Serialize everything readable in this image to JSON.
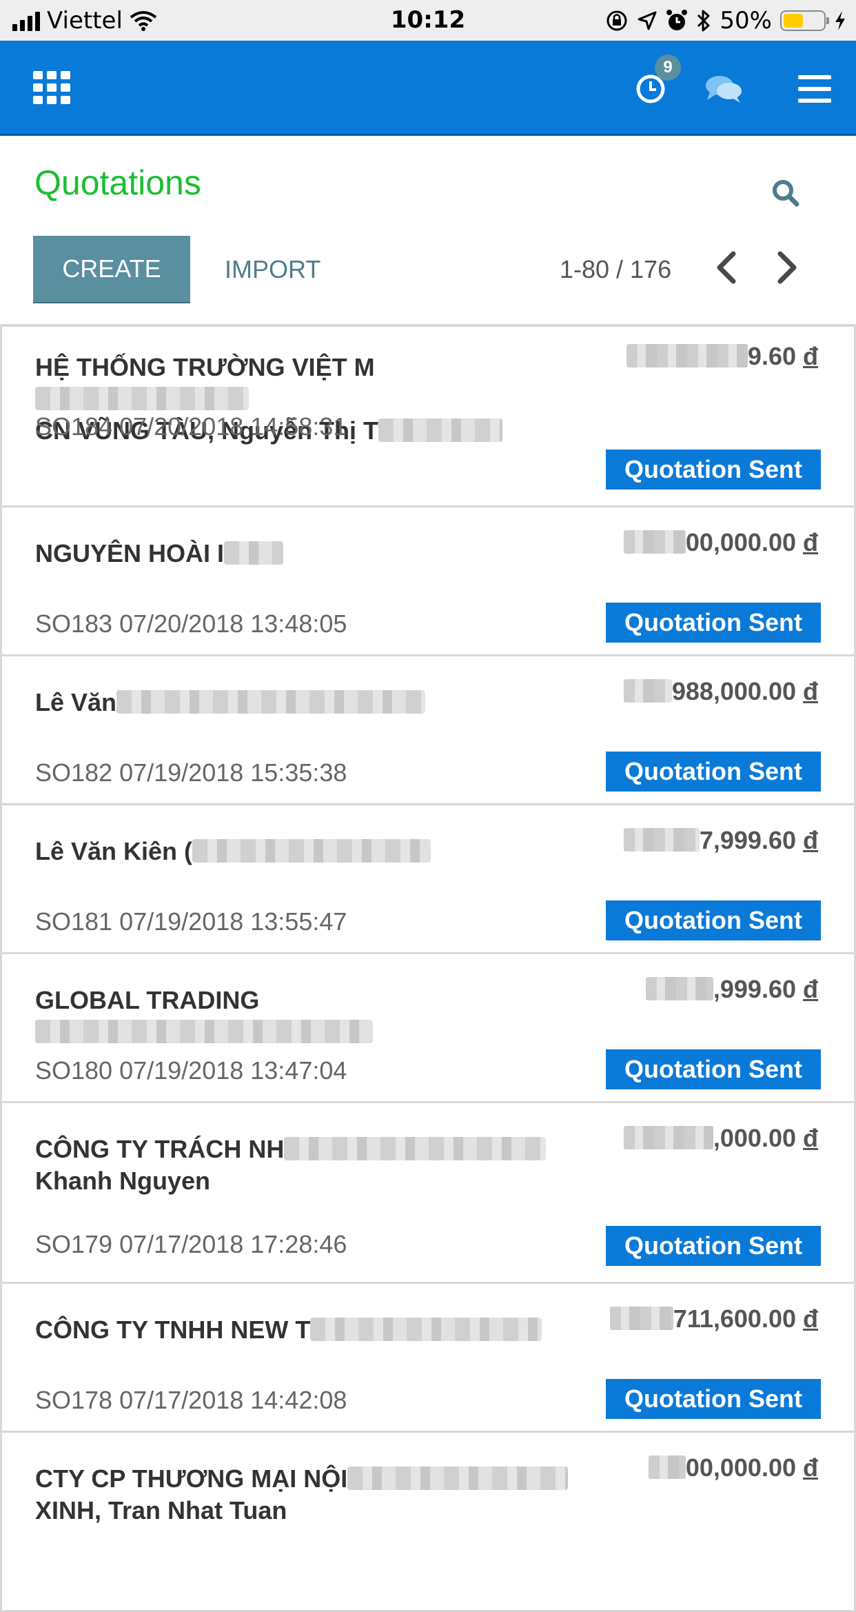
{
  "status_bar": {
    "carrier": "Viettel",
    "time": "10:12",
    "battery": "50%",
    "battery_level": 0.5
  },
  "navbar": {
    "notification_count": "9",
    "icons": [
      "apps-grid-icon",
      "clock-icon",
      "chat-icon",
      "hamburger-menu-icon"
    ],
    "color": "#0a7ad8"
  },
  "control_panel": {
    "title": "Quotations",
    "create_label": "CREATE",
    "import_label": "IMPORT",
    "pager_value": "1-80 / 176",
    "title_color": "#1bbd32",
    "button_color": "#5a8fa0"
  },
  "quotations": [
    {
      "customer_line1": "HỆ THỐNG TRƯỜNG VIỆT M",
      "customer_line2": "CN VŨNG TÀU, Nguyễn Thị T",
      "amount": "9.60",
      "currency": "đ",
      "reference": "SO184 07/20/2018 14:58:31",
      "status": "Quotation Sent"
    },
    {
      "customer_line1": "NGUYÊN HOÀI I",
      "customer_line2": "",
      "amount": "00,000.00",
      "currency": "đ",
      "reference": "SO183 07/20/2018 13:48:05",
      "status": "Quotation Sent"
    },
    {
      "customer_line1": "Lê Văn",
      "customer_line2": "",
      "amount": "988,000.00",
      "currency": "đ",
      "reference": "SO182 07/19/2018 15:35:38",
      "status": "Quotation Sent"
    },
    {
      "customer_line1": "Lê Văn Kiên (",
      "customer_line2": "",
      "amount": "7,999.60",
      "currency": "đ",
      "reference": "SO181 07/19/2018 13:55:47",
      "status": "Quotation Sent"
    },
    {
      "customer_line1": "GLOBAL TRADING",
      "customer_line2": "",
      "amount": ",999.60",
      "currency": "đ",
      "reference": "SO180 07/19/2018 13:47:04",
      "status": "Quotation Sent"
    },
    {
      "customer_line1": "CÔNG TY TRÁCH NH",
      "customer_line2": "Khanh Nguyen",
      "amount": ",000.00",
      "currency": "đ",
      "reference": "SO179 07/17/2018 17:28:46",
      "status": "Quotation Sent"
    },
    {
      "customer_line1": "CÔNG TY TNHH NEW T",
      "customer_line2": "",
      "amount": "711,600.00",
      "currency": "đ",
      "reference": "SO178 07/17/2018 14:42:08",
      "status": "Quotation Sent"
    },
    {
      "customer_line1": "CTY CP THƯƠNG MẠI NỘI",
      "customer_line2": "XINH, Tran Nhat Tuan",
      "amount": "00,000.00",
      "currency": "đ",
      "reference": "",
      "status": ""
    }
  ]
}
